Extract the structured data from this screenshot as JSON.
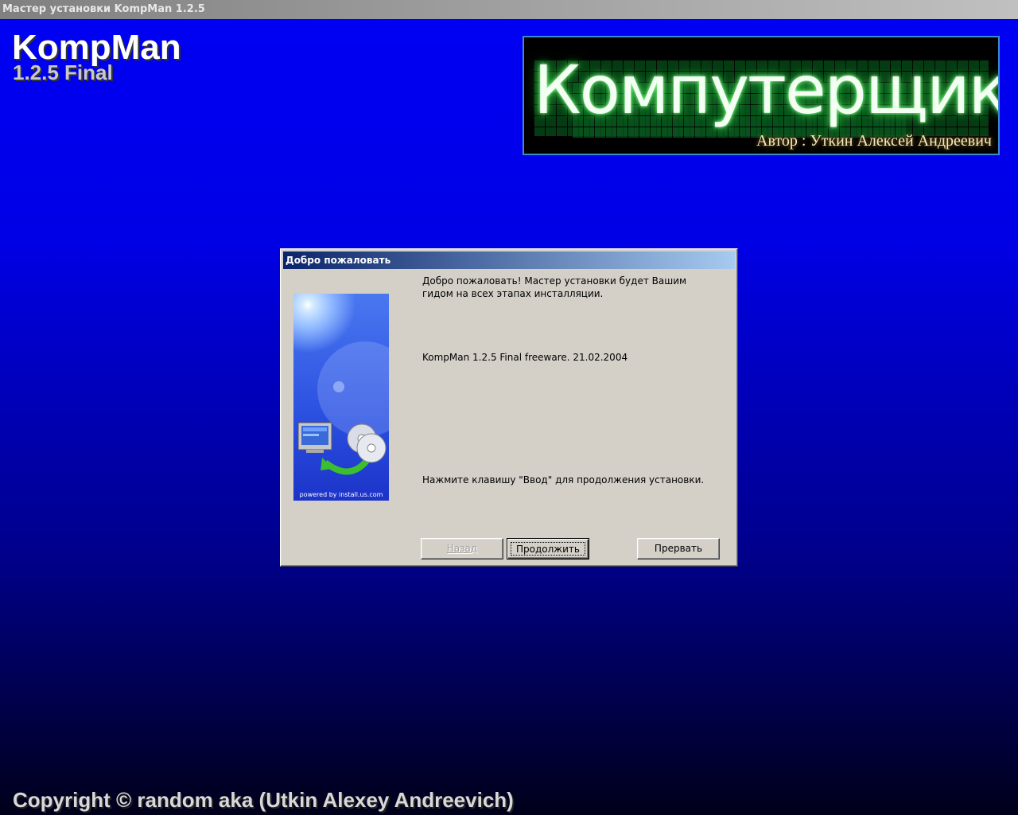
{
  "window": {
    "title": "Мастер установки KompMan 1.2.5"
  },
  "header": {
    "app_name": "KompMan",
    "version": "1.2.5 Final"
  },
  "banner": {
    "title": "Компутерщик",
    "author": "Автор : Уткин Алексей Андреевич"
  },
  "dialog": {
    "title": "Добро пожаловать",
    "intro_line1": "Добро пожаловать! Мастер установки будет Вашим",
    "intro_line2": "гидом на всех этапах инсталляции.",
    "product_info": "KompMan 1.2.5 Final freeware. 21.02.2004",
    "instruction": "Нажмите клавишу \"Ввод\" для продолжения установки.",
    "image_footer": "powered by install.us.com",
    "buttons": {
      "back": "Назад",
      "next": "Продолжить",
      "cancel": "Прервать"
    }
  },
  "footer": {
    "copyright": "Copyright © random aka (Utkin Alexey Andreevich)"
  },
  "colors": {
    "background_top": "#0000f4",
    "background_bottom": "#00001a",
    "dialog_face": "#d4d0c8",
    "title_active_start": "#0a246a",
    "title_active_end": "#a6caf0"
  }
}
